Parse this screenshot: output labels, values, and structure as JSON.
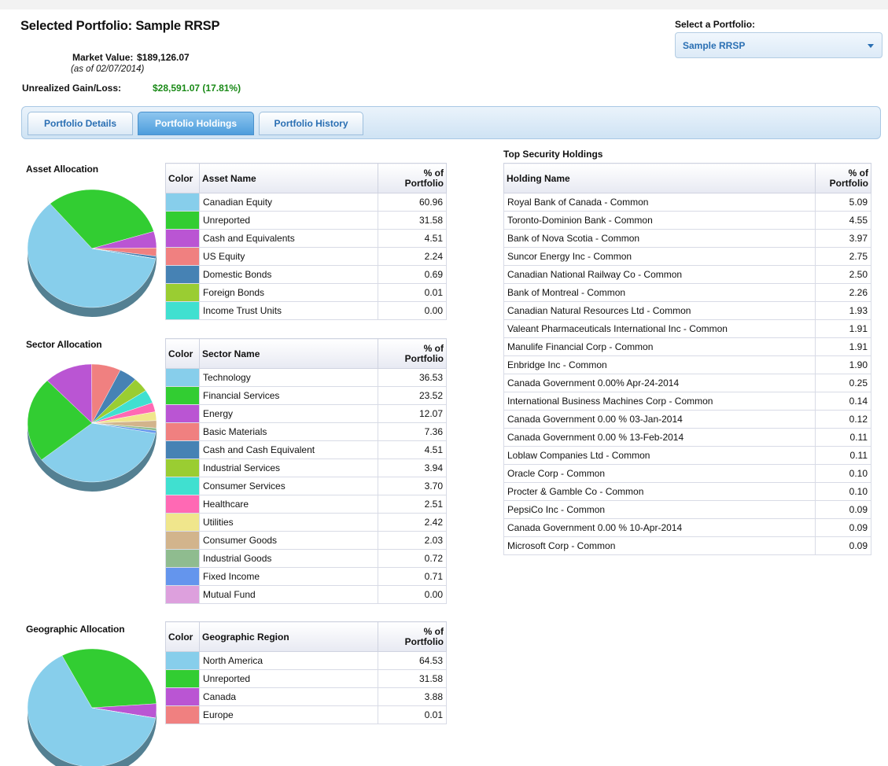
{
  "header": {
    "title": "Selected Portfolio: Sample RRSP",
    "market_value_label": "Market Value:",
    "market_value": "$189,126.07",
    "as_of": "(as of 02/07/2014)",
    "gain_label": "Unrealized Gain/Loss:",
    "gain_value": "$28,591.07 (17.81%)",
    "gain_color": "#1a8a17"
  },
  "selector": {
    "label": "Select a Portfolio:",
    "selected": "Sample RRSP",
    "icon": "chevron-down-icon"
  },
  "tabs": [
    {
      "label": "Portfolio Details",
      "active": false
    },
    {
      "label": "Portfolio Holdings",
      "active": true
    },
    {
      "label": "Portfolio History",
      "active": false
    }
  ],
  "pct_header_line1": "% of",
  "pct_header_line2": "Portfolio",
  "color_header": "Color",
  "asset": {
    "title": "Asset Allocation",
    "name_header": "Asset Name",
    "rows": [
      {
        "name": "Canadian Equity",
        "value": "60.96",
        "color": "#87ceeb"
      },
      {
        "name": "Unreported",
        "value": "31.58",
        "color": "#32cd32"
      },
      {
        "name": "Cash and Equivalents",
        "value": "4.51",
        "color": "#ba55d3"
      },
      {
        "name": "US Equity",
        "value": "2.24",
        "color": "#f08080"
      },
      {
        "name": "Domestic Bonds",
        "value": "0.69",
        "color": "#4682b4"
      },
      {
        "name": "Foreign Bonds",
        "value": "0.01",
        "color": "#9acd32"
      },
      {
        "name": "Income Trust Units",
        "value": "0.00",
        "color": "#40e0d0"
      }
    ]
  },
  "sector": {
    "title": "Sector Allocation",
    "name_header": "Sector Name",
    "rows": [
      {
        "name": "Technology",
        "value": "36.53",
        "color": "#87ceeb"
      },
      {
        "name": "Financial Services",
        "value": "23.52",
        "color": "#32cd32"
      },
      {
        "name": "Energy",
        "value": "12.07",
        "color": "#ba55d3"
      },
      {
        "name": "Basic Materials",
        "value": "7.36",
        "color": "#f08080"
      },
      {
        "name": "Cash and Cash Equivalent",
        "value": "4.51",
        "color": "#4682b4"
      },
      {
        "name": "Industrial Services",
        "value": "3.94",
        "color": "#9acd32"
      },
      {
        "name": "Consumer Services",
        "value": "3.70",
        "color": "#40e0d0"
      },
      {
        "name": "Healthcare",
        "value": "2.51",
        "color": "#ff69b4"
      },
      {
        "name": "Utilities",
        "value": "2.42",
        "color": "#f0e68c"
      },
      {
        "name": "Consumer Goods",
        "value": "2.03",
        "color": "#d2b48c"
      },
      {
        "name": "Industrial Goods",
        "value": "0.72",
        "color": "#8fbc8f"
      },
      {
        "name": "Fixed Income",
        "value": "0.71",
        "color": "#6495ed"
      },
      {
        "name": "Mutual Fund",
        "value": "0.00",
        "color": "#dda0dd"
      }
    ]
  },
  "geo": {
    "title": "Geographic Allocation",
    "name_header": "Geographic Region",
    "rows": [
      {
        "name": "North America",
        "value": "64.53",
        "color": "#87ceeb"
      },
      {
        "name": "Unreported",
        "value": "31.58",
        "color": "#32cd32"
      },
      {
        "name": "Canada",
        "value": "3.88",
        "color": "#ba55d3"
      },
      {
        "name": "Europe",
        "value": "0.01",
        "color": "#f08080"
      }
    ]
  },
  "holdings": {
    "title": "Top Security Holdings",
    "name_header": "Holding Name",
    "rows": [
      {
        "name": "Royal Bank of Canada - Common",
        "value": "5.09"
      },
      {
        "name": "Toronto-Dominion Bank - Common",
        "value": "4.55"
      },
      {
        "name": "Bank of Nova Scotia - Common",
        "value": "3.97"
      },
      {
        "name": "Suncor Energy Inc - Common",
        "value": "2.75"
      },
      {
        "name": "Canadian National Railway Co - Common",
        "value": "2.50"
      },
      {
        "name": "Bank of Montreal - Common",
        "value": "2.26"
      },
      {
        "name": "Canadian Natural Resources Ltd - Common",
        "value": "1.93"
      },
      {
        "name": "Valeant Pharmaceuticals International Inc - Common",
        "value": "1.91"
      },
      {
        "name": "Manulife Financial Corp - Common",
        "value": "1.91"
      },
      {
        "name": "Enbridge Inc - Common",
        "value": "1.90"
      },
      {
        "name": "Canada Government 0.00% Apr-24-2014",
        "value": "0.25"
      },
      {
        "name": "International Business Machines Corp - Common",
        "value": "0.14"
      },
      {
        "name": "Canada Government 0.00 % 03-Jan-2014",
        "value": "0.12"
      },
      {
        "name": "Canada Government 0.00 % 13-Feb-2014",
        "value": "0.11"
      },
      {
        "name": "Loblaw Companies Ltd - Common",
        "value": "0.11"
      },
      {
        "name": "Oracle Corp - Common",
        "value": "0.10"
      },
      {
        "name": "Procter & Gamble Co - Common",
        "value": "0.10"
      },
      {
        "name": "PepsiCo Inc - Common",
        "value": "0.09"
      },
      {
        "name": "Canada Government 0.00 % 10-Apr-2014",
        "value": "0.09"
      },
      {
        "name": "Microsoft Corp - Common",
        "value": "0.09"
      }
    ]
  }
}
